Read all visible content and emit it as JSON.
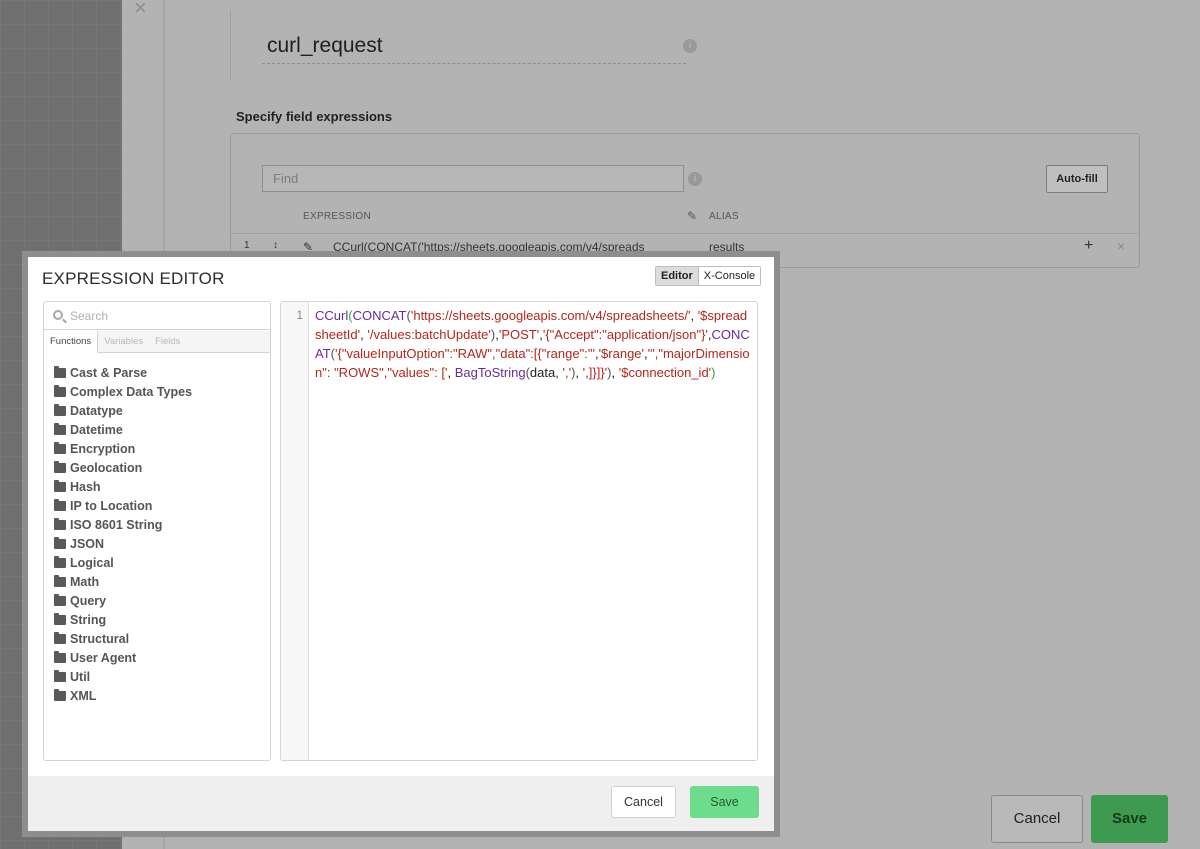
{
  "background": {
    "close_glyph": "×",
    "node_name": "curl_request",
    "info_glyph": "i",
    "section_label": "Specify field expressions",
    "find_placeholder": "Find",
    "autofill_label": "Auto-fill",
    "col_expression": "EXPRESSION",
    "col_alias": "ALIAS",
    "row": {
      "number": "1",
      "move_glyph": "↕",
      "expression": "CCurl(CONCAT('https://sheets.googleapis.com/v4/spreads",
      "alias": "results",
      "add_glyph": "+",
      "remove_glyph": "×"
    },
    "cancel_label": "Cancel",
    "save_label": "Save"
  },
  "modal": {
    "title": "EXPRESSION EDITOR",
    "mode_tabs": [
      "Editor",
      "X-Console"
    ],
    "active_mode": "Editor",
    "search_placeholder": "Search",
    "tabs": [
      "Functions",
      "Variables",
      "Fields"
    ],
    "active_tab": "Functions",
    "categories": [
      "Cast & Parse",
      "Complex Data Types",
      "Datatype",
      "Datetime",
      "Encryption",
      "Geolocation",
      "Hash",
      "IP to Location",
      "ISO 8601 String",
      "JSON",
      "Logical",
      "Math",
      "Query",
      "String",
      "Structural",
      "User Agent",
      "Util",
      "XML"
    ],
    "editor": {
      "line_number": "1",
      "code": "CCurl(CONCAT('https://sheets.googleapis.com/v4/spreadsheets/', '$spreadsheetId', '/values:batchUpdate'),'POST','{\"Accept\":\"application/json\"}',CONCAT('{\"valueInputOption\":\"RAW\",\"data\":[{\"range\":\"','$range','\",\"majorDimension\": \"ROWS\",\"values\": [', BagToString(data, ','), ',]}]}'), '$connection_id')"
    },
    "cancel_label": "Cancel",
    "save_label": "Save"
  },
  "colors": {
    "function": "#6a2c9a",
    "string": "#b5261b",
    "save_button": "#6ddc8d"
  }
}
